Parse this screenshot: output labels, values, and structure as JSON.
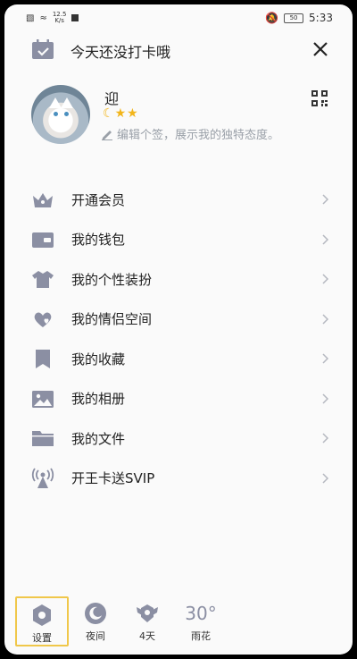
{
  "status_bar": {
    "net_speed_value": "12.5",
    "net_speed_unit": "K/s",
    "battery": "50",
    "time": "5:33"
  },
  "header": {
    "checkin_text": "今天还没打卡哦"
  },
  "profile": {
    "username": "迎",
    "signature": "编辑个签，展示我的独特态度。"
  },
  "menu": {
    "items": [
      {
        "label": "开通会员",
        "icon": "crown-icon"
      },
      {
        "label": "我的钱包",
        "icon": "wallet-icon"
      },
      {
        "label": "我的个性装扮",
        "icon": "tshirt-icon"
      },
      {
        "label": "我的情侣空间",
        "icon": "hearts-icon"
      },
      {
        "label": "我的收藏",
        "icon": "bookmark-icon"
      },
      {
        "label": "我的相册",
        "icon": "photo-icon"
      },
      {
        "label": "我的文件",
        "icon": "folder-icon"
      },
      {
        "label": "开王卡送SVIP",
        "icon": "signal-tower-icon"
      }
    ]
  },
  "bottom_bar": {
    "settings_label": "设置",
    "night_label": "夜间",
    "days_label": "4天",
    "weather_temp": "30°",
    "weather_label": "雨花"
  },
  "colors": {
    "icon": "#8b8fa3",
    "accent": "#f2b51a",
    "selected_border": "#f0c74a"
  }
}
